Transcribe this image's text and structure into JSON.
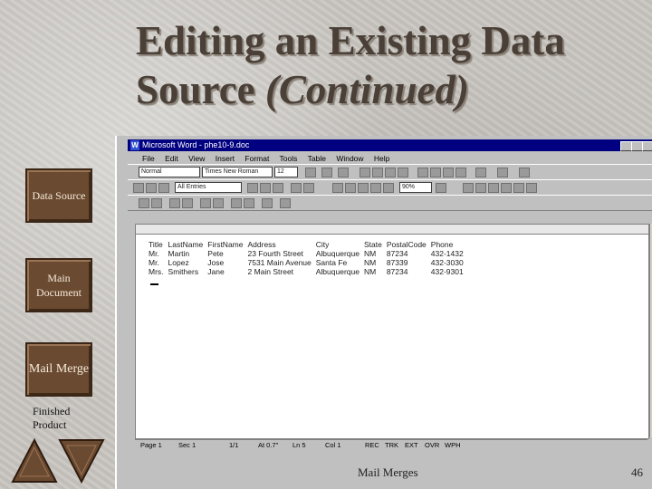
{
  "slide": {
    "title_line1": "Editing an Existing Data",
    "title_line2": "Source ",
    "title_italic": "(Continued)",
    "footer": "Mail Merges",
    "page_number": "46"
  },
  "nav": {
    "data_source": "Data Source",
    "main_document": "Main Document",
    "mail_merge": "Mail Merge",
    "finished_product": "Finished Product"
  },
  "word": {
    "window_title": "Microsoft Word - phe10-9.doc",
    "menu": [
      "File",
      "Edit",
      "View",
      "Insert",
      "Format",
      "Tools",
      "Table",
      "Window",
      "Help"
    ],
    "style_box": "Normal",
    "font_box": "Times New Roman",
    "size_box": "12",
    "zoom_box": "90%",
    "all_entries": "All Entries",
    "table": {
      "headers": [
        "Title",
        "LastName",
        "FirstName",
        "Address",
        "City",
        "State",
        "PostalCode",
        "Phone"
      ],
      "rows": [
        [
          "Mr.",
          "Martin",
          "Pete",
          "23 Fourth Street",
          "Albuquerque",
          "NM",
          "87234",
          "432-1432"
        ],
        [
          "Mr.",
          "Lopez",
          "Jose",
          "7531 Main Avenue",
          "Santa Fe",
          "NM",
          "87339",
          "432-3030"
        ],
        [
          "Mrs.",
          "Smithers",
          "Jane",
          "2 Main Street",
          "Albuquerque",
          "NM",
          "87234",
          "432-9301"
        ]
      ]
    },
    "status": {
      "page": "Page 1",
      "sec": "Sec 1",
      "pos": "1/1",
      "at": "At 0.7\"",
      "ln": "Ln 5",
      "col": "Col 1",
      "modes": [
        "REC",
        "TRK",
        "EXT",
        "OVR",
        "WPH"
      ]
    }
  }
}
